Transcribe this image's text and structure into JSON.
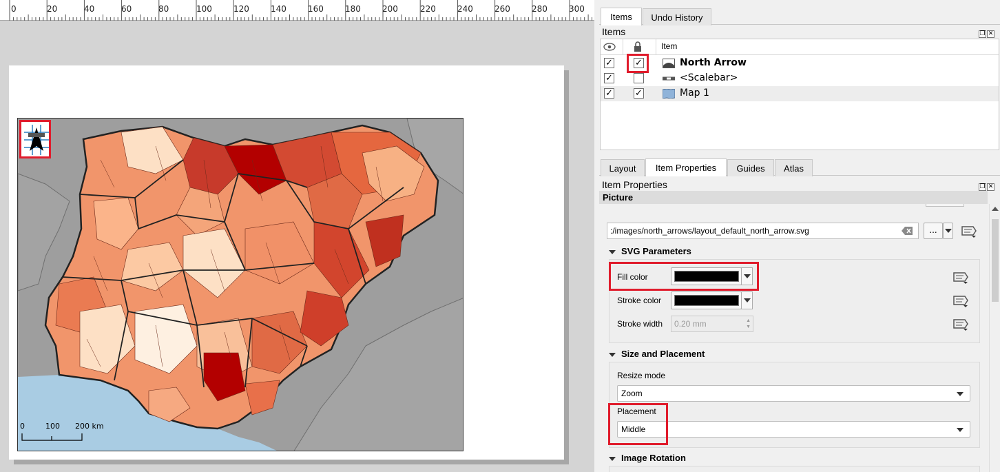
{
  "ruler": {
    "labels": [
      "0",
      "20",
      "40",
      "60",
      "80",
      "100",
      "120",
      "140",
      "160",
      "180",
      "200",
      "220",
      "240",
      "260",
      "280",
      "300"
    ]
  },
  "map": {
    "scalebar": {
      "labels": [
        "0",
        "100",
        "200 km"
      ]
    },
    "colors": {
      "background": "#9e9e9e",
      "water": "#a9cce3",
      "region_light": "#fde0c5",
      "region_mid": "#f1956b",
      "region_dark": "#c73a2b",
      "region_darkest": "#b30000",
      "highlight": "#e01c2c"
    }
  },
  "top_tabs": {
    "items": "Items",
    "undo_history": "Undo History"
  },
  "items_panel": {
    "title": "Items",
    "header_item": "Item",
    "rows": [
      {
        "visible": "✓",
        "locked": "✓",
        "label": "North Arrow"
      },
      {
        "visible": "✓",
        "locked": "",
        "label": "<Scalebar>"
      },
      {
        "visible": "✓",
        "locked": "✓",
        "label": "Map 1"
      }
    ]
  },
  "bottom_tabs": {
    "layout": "Layout",
    "item_properties": "Item Properties",
    "guides": "Guides",
    "atlas": "Atlas"
  },
  "properties": {
    "title": "Item Properties",
    "section": "Picture",
    "path": ":/images/north_arrows/layout_default_north_arrow.svg",
    "browse_label": "...",
    "svg_params": {
      "title": "SVG Parameters",
      "fill_label": "Fill color",
      "stroke_label": "Stroke color",
      "stroke_width_label": "Stroke width",
      "stroke_width_value": "0.20 mm",
      "fill_color": "#000000",
      "stroke_color": "#000000"
    },
    "size_placement": {
      "title": "Size and Placement",
      "resize_label": "Resize mode",
      "resize_value": "Zoom",
      "placement_label": "Placement",
      "placement_value": "Middle"
    },
    "image_rotation": {
      "title": "Image Rotation"
    }
  },
  "icons": [
    "eye-icon",
    "lock-icon",
    "north-arrow-item-icon",
    "scalebar-item-icon",
    "map-item-icon",
    "clear-icon",
    "data-defined-icon",
    "float-icon",
    "close-icon"
  ]
}
